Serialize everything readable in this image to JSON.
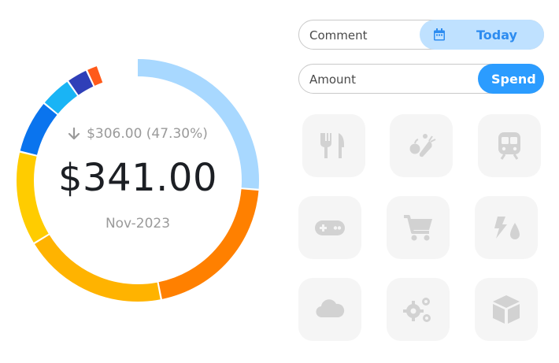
{
  "summary": {
    "delta_text": "$306.00 (47.30%)",
    "total": "$341.00",
    "period": "Nov-2023"
  },
  "inputs": {
    "comment_label": "Comment",
    "today_label": "Today",
    "amount_label": "Amount",
    "spend_label": "Spend"
  },
  "donut_segments": [
    {
      "color": "#a8d8ff",
      "fraction": 0.2635
    },
    {
      "color": "#ff8000",
      "fraction": 0.2065
    },
    {
      "color": "#ffb300",
      "fraction": 0.194
    },
    {
      "color": "#ffcc00",
      "fraction": 0.125
    },
    {
      "color": "#0a74ee",
      "fraction": 0.0715
    },
    {
      "color": "#19b4f5",
      "fraction": 0.0425
    },
    {
      "color": "#2f3fb8",
      "fraction": 0.0285
    },
    {
      "color": "#ff5a1a",
      "fraction": 0.0155
    }
  ],
  "categories": [
    {
      "icon": "utensils-icon"
    },
    {
      "icon": "groceries-icon"
    },
    {
      "icon": "train-icon"
    },
    {
      "icon": "gamepad-icon"
    },
    {
      "icon": "shopping-cart-icon"
    },
    {
      "icon": "utilities-icon"
    },
    {
      "icon": "cloud-icon"
    },
    {
      "icon": "cogs-icon"
    },
    {
      "icon": "box-icon"
    }
  ],
  "colors": {
    "accent": "#2b9cff",
    "accent_light": "#bfe1ff",
    "tile_bg": "#f5f5f5",
    "icon_gray": "#d2d2d2"
  }
}
